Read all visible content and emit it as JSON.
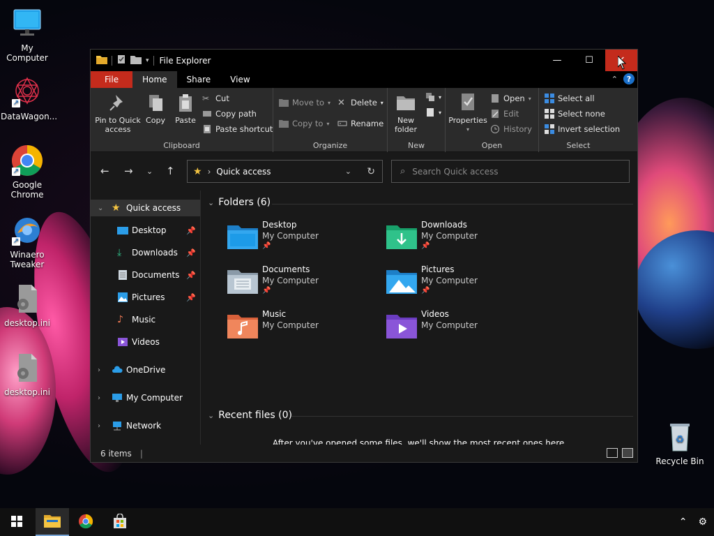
{
  "desktop": {
    "icons": [
      {
        "label": "My Computer"
      },
      {
        "label": "DataWagon..."
      },
      {
        "label": "Google Chrome"
      },
      {
        "label": "Winaero Tweaker"
      },
      {
        "label": "desktop.ini"
      },
      {
        "label": "desktop.ini"
      },
      {
        "label": "Recycle Bin"
      }
    ]
  },
  "window": {
    "title": "File Explorer",
    "tabs": [
      {
        "label": "File"
      },
      {
        "label": "Home"
      },
      {
        "label": "Share"
      },
      {
        "label": "View"
      }
    ],
    "ribbon": {
      "clipboard": {
        "pin": "Pin to Quick access",
        "copy": "Copy",
        "paste": "Paste",
        "cut": "Cut",
        "copy_path": "Copy path",
        "paste_shortcut": "Paste shortcut",
        "label": "Clipboard"
      },
      "organize": {
        "move_to": "Move to",
        "copy_to": "Copy to",
        "delete": "Delete",
        "rename": "Rename",
        "label": "Organize"
      },
      "new": {
        "new_folder": "New folder",
        "label": "New"
      },
      "open": {
        "properties": "Properties",
        "open": "Open",
        "edit": "Edit",
        "history": "History",
        "label": "Open"
      },
      "select": {
        "select_all": "Select all",
        "select_none": "Select none",
        "invert_selection": "Invert selection",
        "label": "Select"
      }
    },
    "address": {
      "path": "Quick access",
      "search_placeholder": "Search Quick access"
    },
    "navpane": {
      "items": [
        {
          "label": "Quick access"
        },
        {
          "label": "Desktop"
        },
        {
          "label": "Downloads"
        },
        {
          "label": "Documents"
        },
        {
          "label": "Pictures"
        },
        {
          "label": "Music"
        },
        {
          "label": "Videos"
        },
        {
          "label": "OneDrive"
        },
        {
          "label": "My Computer"
        },
        {
          "label": "Network"
        }
      ]
    },
    "content": {
      "folders_header": "Folders (6)",
      "folders": [
        {
          "name": "Desktop",
          "location": "My Computer"
        },
        {
          "name": "Downloads",
          "location": "My Computer"
        },
        {
          "name": "Documents",
          "location": "My Computer"
        },
        {
          "name": "Pictures",
          "location": "My Computer"
        },
        {
          "name": "Music",
          "location": "My Computer"
        },
        {
          "name": "Videos",
          "location": "My Computer"
        }
      ],
      "recent_header": "Recent files (0)",
      "recent_empty": "After you've opened some files, we'll show the most recent ones here."
    },
    "status": {
      "items": "6 items"
    }
  },
  "colors": {
    "close_red": "#c42b1c",
    "accent_blue": "#1a6fc9",
    "folder_yellow": "#f4c442"
  }
}
